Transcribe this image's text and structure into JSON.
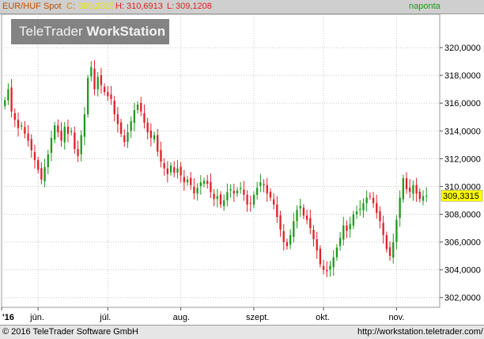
{
  "header": {
    "symbol_label": "EUR/HUF Spot",
    "close_label": "C:",
    "close_value": "309,3315",
    "high_label": "H:",
    "high_value": "310,6913",
    "low_label": "L:",
    "low_value": "309,1208",
    "period_label": "naponta"
  },
  "watermark": {
    "text_light": "TeleTrader ",
    "text_bold": "WorkStation"
  },
  "footer": {
    "copyright": "© 2016 TeleTrader Software GmbH",
    "url": "http://workstation.teletrader.com/"
  },
  "colors": {
    "up": "#1f9a1f",
    "down": "#e0202a",
    "last_price_bg": "#ffff00",
    "header_bg": "#cfcfcf"
  },
  "chart_data": {
    "type": "candlestick",
    "title": "EUR/HUF Spot",
    "period": "naponta",
    "last_price": "309,3315",
    "last_price_value": 309.3315,
    "ylim": [
      301.3,
      322.4
    ],
    "xlim": [
      0,
      132
    ],
    "grid": true,
    "y_ticks": [
      {
        "v": 302,
        "label": "302,0000"
      },
      {
        "v": 304,
        "label": "304,0000"
      },
      {
        "v": 306,
        "label": "306,0000"
      },
      {
        "v": 308,
        "label": "308,0000"
      },
      {
        "v": 310,
        "label": "310,0000"
      },
      {
        "v": 312,
        "label": "312,0000"
      },
      {
        "v": 314,
        "label": "314,0000"
      },
      {
        "v": 316,
        "label": "316,0000"
      },
      {
        "v": 318,
        "label": "318,0000"
      },
      {
        "v": 320,
        "label": "320,0000"
      }
    ],
    "x_ticks": [
      {
        "i": 0,
        "label": "'16"
      },
      {
        "i": 11,
        "label": "jún."
      },
      {
        "i": 32,
        "label": "júl."
      },
      {
        "i": 54,
        "label": "aug."
      },
      {
        "i": 76,
        "label": "szept."
      },
      {
        "i": 97,
        "label": "okt."
      },
      {
        "i": 119,
        "label": "nov."
      }
    ],
    "close_series": [
      316.2,
      317.0,
      315.4,
      314.8,
      314.2,
      314.4,
      313.8,
      313.3,
      312.6,
      311.9,
      311.2,
      310.5,
      311.4,
      312.3,
      313.5,
      314.4,
      313.9,
      313.3,
      314.3,
      313.8,
      314.0,
      312.7,
      312.2,
      313.7,
      315.2,
      317.8,
      318.6,
      317.0,
      317.9,
      317.3,
      316.8,
      316.5,
      316.3,
      315.2,
      314.5,
      313.8,
      313.2,
      313.9,
      314.7,
      315.5,
      315.9,
      315.4,
      314.6,
      313.9,
      313.5,
      313.7,
      312.5,
      311.8,
      311.3,
      310.9,
      311.5,
      311.0,
      311.3,
      310.8,
      310.3,
      310.5,
      310.1,
      309.5,
      309.9,
      310.3,
      310.4,
      310.2,
      309.6,
      309.1,
      309.3,
      308.7,
      309.0,
      309.6,
      309.8,
      309.5,
      309.7,
      309.9,
      309.4,
      308.7,
      308.8,
      309.4,
      309.9,
      310.3,
      310.1,
      309.5,
      309.2,
      308.7,
      307.8,
      306.9,
      306.0,
      305.7,
      306.5,
      307.5,
      308.3,
      308.6,
      307.9,
      307.6,
      307.0,
      306.2,
      305.4,
      304.4,
      304.0,
      303.9,
      304.3,
      304.9,
      305.6,
      306.3,
      307.2,
      306.8,
      307.3,
      308.0,
      308.2,
      308.4,
      308.8,
      309.2,
      309.3,
      308.8,
      308.1,
      307.5,
      306.5,
      305.5,
      305.0,
      306.0,
      307.6,
      309.2,
      310.6,
      309.8,
      309.6,
      310.1,
      309.5,
      309.1,
      309.3,
      309.3315
    ]
  }
}
